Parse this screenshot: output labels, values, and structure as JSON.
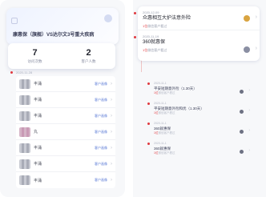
{
  "left": {
    "banner_title": "康惠保（旗舰）VS达尔文3号重大疾病",
    "stats": [
      {
        "value": "7",
        "label": "访问次数"
      },
      {
        "value": "2",
        "label": "客户人数"
      }
    ],
    "date": "2020-11-28",
    "items": [
      {
        "name": "丰涌",
        "tag": "客户画像"
      },
      {
        "name": "丰涌",
        "tag": "客户画像"
      },
      {
        "name": "丰涌",
        "tag": "客户画像"
      },
      {
        "name": "丸",
        "tag": "客户画像"
      },
      {
        "name": "丰涌",
        "tag": "客户画像"
      },
      {
        "name": "丰涌",
        "tag": "客户画像"
      },
      {
        "name": "丰涌",
        "tag": "客户画像"
      }
    ]
  },
  "right": {
    "card": [
      {
        "date": "2020-12-09",
        "title": "众惠相互大护法意外险",
        "sub_count": "1位",
        "sub_text": "微信客户看过"
      },
      {
        "date": "2020-11-19",
        "title": "360就惠保",
        "sub_count": "1位",
        "sub_text": "微信客户看过"
      }
    ],
    "small": [
      {
        "date": "2020-11-1",
        "title": "平安短期意外险（1.30天）",
        "sub_count": "1位",
        "sub_text": "微信客户看过"
      },
      {
        "date": "2020-11-1",
        "title": "平安短期意外险和优（1.30天）",
        "sub_count": "1位",
        "sub_text": "微信客户看过"
      },
      {
        "date": "2020-11-1",
        "title": "360就惠保",
        "sub_count": "1位",
        "sub_text": "微信客户看过"
      },
      {
        "date": "2020-11-1",
        "title": "360就惠保",
        "sub_count": "1位",
        "sub_text": "微信客户看过"
      }
    ]
  }
}
